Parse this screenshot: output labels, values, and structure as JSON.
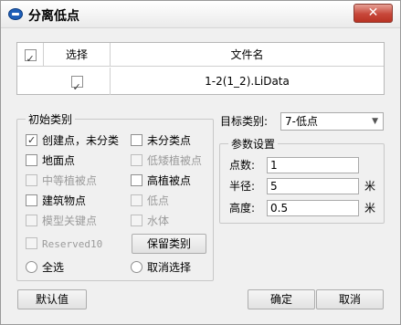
{
  "window": {
    "title": "分离低点",
    "close_label": "✕"
  },
  "file_table": {
    "headers": {
      "check": "✓",
      "select": "选择",
      "name": "文件名"
    },
    "rows": [
      {
        "checked": true,
        "name": "1-2(1_2).LiData"
      }
    ]
  },
  "initial_class": {
    "title": "初始类别",
    "items": {
      "created_unclassified": {
        "label": "创建点，未分类",
        "checked": true,
        "enabled": true
      },
      "unclassified": {
        "label": "未分类点",
        "checked": false,
        "enabled": true
      },
      "ground": {
        "label": "地面点",
        "checked": false,
        "enabled": true
      },
      "low_vegetation": {
        "label": "低矮植被点",
        "checked": false,
        "enabled": false
      },
      "medium_vegetation": {
        "label": "中等植被点",
        "checked": false,
        "enabled": false
      },
      "high_vegetation": {
        "label": "高植被点",
        "checked": false,
        "enabled": true
      },
      "building": {
        "label": "建筑物点",
        "checked": false,
        "enabled": true
      },
      "low_point": {
        "label": "低点",
        "checked": false,
        "enabled": false
      },
      "model_keypoint": {
        "label": "模型关键点",
        "checked": false,
        "enabled": false
      },
      "water": {
        "label": "水体",
        "checked": false,
        "enabled": false
      },
      "reserved10": {
        "label": "Reserved10",
        "checked": false,
        "enabled": false
      }
    },
    "keep_class_button": "保留类别",
    "select_all": "全选",
    "deselect": "取消选择"
  },
  "target_class": {
    "label": "目标类别:",
    "value": "7-低点"
  },
  "params": {
    "title": "参数设置",
    "count_label": "点数:",
    "count_value": "1",
    "radius_label": "半径:",
    "radius_value": "5",
    "radius_unit": "米",
    "height_label": "高度:",
    "height_value": "0.5",
    "height_unit": "米"
  },
  "footer": {
    "default_button": "默认值",
    "ok_button": "确定",
    "cancel_button": "取消"
  }
}
